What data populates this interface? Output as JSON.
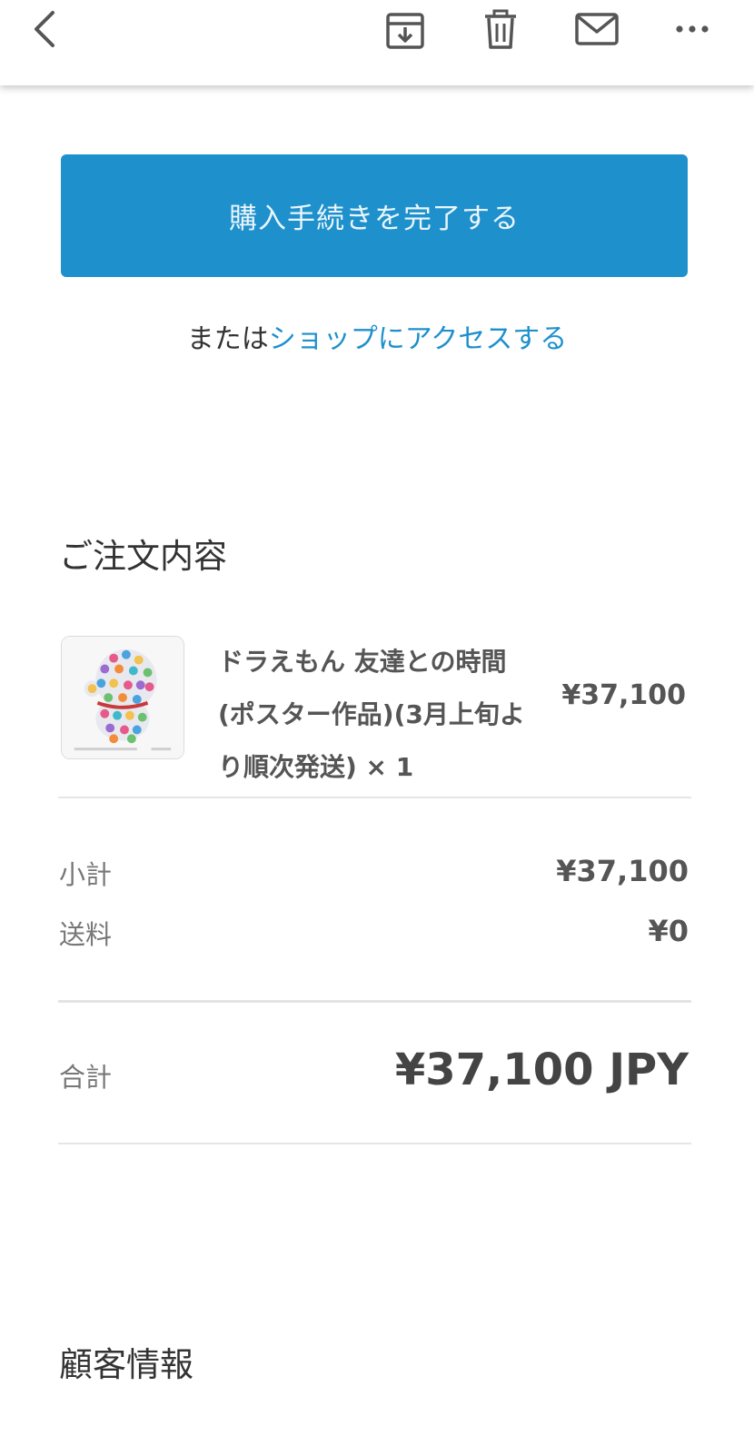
{
  "toolbar": {
    "icons": [
      "back-arrow-icon",
      "archive-icon",
      "trash-icon",
      "mail-icon",
      "more-icon"
    ]
  },
  "checkout": {
    "button_label": "購入手続きを完了する",
    "or_prefix": "または",
    "shop_link": "ショップにアクセスする"
  },
  "order": {
    "title": "ご注文内容",
    "item": {
      "name": "ドラえもん 友達との時間 (ポスター作品)(3月上旬より順次発送) × 1",
      "price": "¥37,100"
    },
    "subtotal_label": "小計",
    "subtotal_value": "¥37,100",
    "shipping_label": "送料",
    "shipping_value": "¥0",
    "total_label": "合計",
    "total_value": "¥37,100 JPY"
  },
  "customer": {
    "title": "顧客情報"
  },
  "colors": {
    "accent": "#1e90cc",
    "text": "#333333",
    "muted": "#777777"
  }
}
